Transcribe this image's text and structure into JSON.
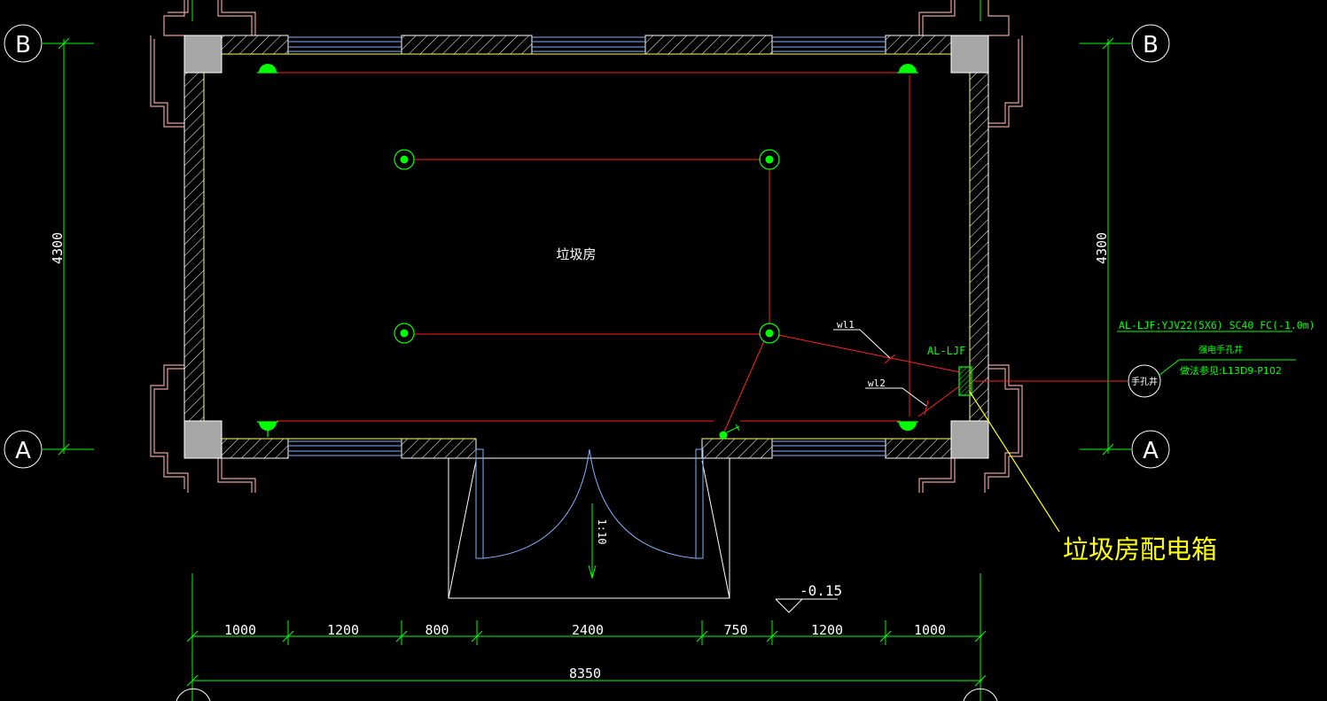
{
  "room_label": "垃圾房",
  "callout_label": "垃圾房配电箱",
  "panel_tag": "AL-LJF",
  "circuits": [
    "wl1",
    "wl2"
  ],
  "cable_spec": "AL-LJF:YJV22(5X6) SC40 FC(-1.0m)",
  "handhole_title": "强电手孔井",
  "handhole_ref": "做法参见:L13D9-P102",
  "handhole_symbol": "手孔井",
  "grid_axes": [
    "A",
    "B"
  ],
  "vertical_dimension": "4300",
  "slope": "1:10",
  "elevation": "-0.15",
  "dimensions": [
    "1000",
    "1200",
    "800",
    "2400",
    "750",
    "1200",
    "1000"
  ],
  "total_dimension": "8350",
  "colors": {
    "background": "#000000",
    "wall": "#ffffff",
    "hatch": "#ffffff",
    "wiring": "#ff2020",
    "fixture": "#00ff00",
    "dimension": "#00ff00",
    "window": "#7fb2ff",
    "callout": "#ffff00",
    "outline": "#e8a0a0",
    "door": "#7fb2ff"
  }
}
